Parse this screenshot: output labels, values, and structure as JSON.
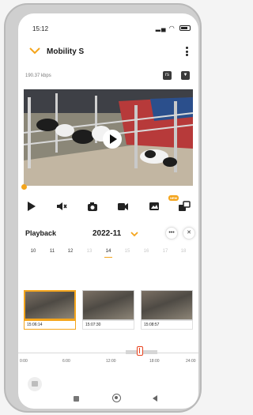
{
  "status_bar": {
    "time": "15:12"
  },
  "header": {
    "title": "Mobility S"
  },
  "stream": {
    "bitrate": "190.37 kbps",
    "badge_1": "rs",
    "badge_2": "▼"
  },
  "controls": {
    "new_badge": "NEW"
  },
  "playback": {
    "label": "Playback",
    "month": "2022-11",
    "more": "•••",
    "close": "✕"
  },
  "days": [
    {
      "label": "10",
      "state": "active"
    },
    {
      "label": "11",
      "state": "active"
    },
    {
      "label": "12",
      "state": "active"
    },
    {
      "label": "13",
      "state": "dim"
    },
    {
      "label": "14",
      "state": "selected"
    },
    {
      "label": "15",
      "state": "dim"
    },
    {
      "label": "16",
      "state": "dim"
    },
    {
      "label": "17",
      "state": "dim"
    },
    {
      "label": "18",
      "state": "dim"
    }
  ],
  "recordings": [
    {
      "time": "15:06:14",
      "selected": true
    },
    {
      "time": "15:07:30",
      "selected": false
    },
    {
      "time": "15:08:57",
      "selected": false
    }
  ],
  "timeline": {
    "ticks": [
      "0:00",
      "6:00",
      "12:00",
      "18:00",
      "24:00"
    ]
  },
  "colors": {
    "accent": "#f4a51c",
    "marker": "#e8431f"
  }
}
